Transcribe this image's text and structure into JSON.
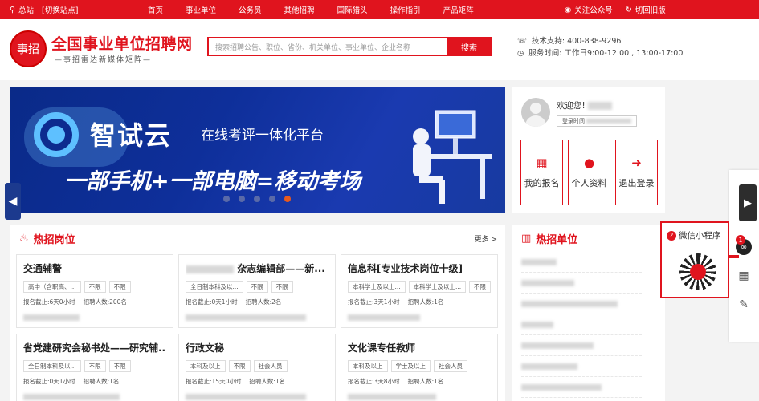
{
  "topbar": {
    "location": "总站",
    "switch": "[切换站点]",
    "nav": [
      "首页",
      "事业单位",
      "公务员",
      "其他招聘",
      "国际猎头",
      "操作指引",
      "产品矩阵"
    ],
    "follow": "关注公众号",
    "old_version": "切回旧版"
  },
  "header": {
    "logo_mark": "事招",
    "site_title": "全国事业单位招聘网",
    "site_subtitle": "—事招雷达新媒体矩阵—",
    "search_placeholder": "搜索招聘公告、职位、省份、机关单位、事业单位、企业名称",
    "search_button": "搜索",
    "support_phone": "技术支持: 400-838-9296",
    "service_time": "服务时间: 工作日9:00-12:00 , 13:00-17:00"
  },
  "banner": {
    "brand": "智试云",
    "slogan": "在线考评一体化平台",
    "headline": "一部手机+一部电脑=移动考场",
    "active_slide": 5,
    "slide_count": 5
  },
  "user": {
    "welcome": "欢迎您!",
    "login_time": "登录时间",
    "actions": [
      "我的报名",
      "个人资料",
      "退出登录"
    ]
  },
  "hot_jobs": {
    "title": "热招岗位",
    "more": "更多 >",
    "cards": [
      {
        "title": "交通辅警",
        "tags": [
          "高中（含职高、...",
          "不限",
          "不限"
        ],
        "deadline": "报名截止:6天0小时",
        "count": "招聘人数:200名"
      },
      {
        "title": "杂志编辑部——新...",
        "tags": [
          "全日制本科及以...",
          "不限",
          "不限"
        ],
        "deadline": "报名截止:0天1小时",
        "count": "招聘人数:2名"
      },
      {
        "title": "信息科[专业技术岗位十级]",
        "tags": [
          "本科学士及以上...",
          "本科学士及以上...",
          "不限"
        ],
        "deadline": "报名截止:3天1小时",
        "count": "招聘人数:1名"
      },
      {
        "title": "省党建研究会秘书处——研究辅...",
        "tags": [
          "全日制本科及以...",
          "不限",
          "不限"
        ],
        "deadline": "报名截止:0天1小时",
        "count": "招聘人数:1名"
      },
      {
        "title": "行政文秘",
        "tags": [
          "本科及以上",
          "不限",
          "社会人员"
        ],
        "deadline": "报名截止:15天0小时",
        "count": "招聘人数:1名"
      },
      {
        "title": "文化课专任教师",
        "tags": [
          "本科及以上",
          "学士及以上",
          "社会人员"
        ],
        "deadline": "报名截止:3天8小时",
        "count": "招聘人数:1名"
      }
    ]
  },
  "hot_units": {
    "title": "热招单位"
  },
  "miniprogram": {
    "label": "微信小程序",
    "badge1": "1",
    "badge2": "2"
  }
}
